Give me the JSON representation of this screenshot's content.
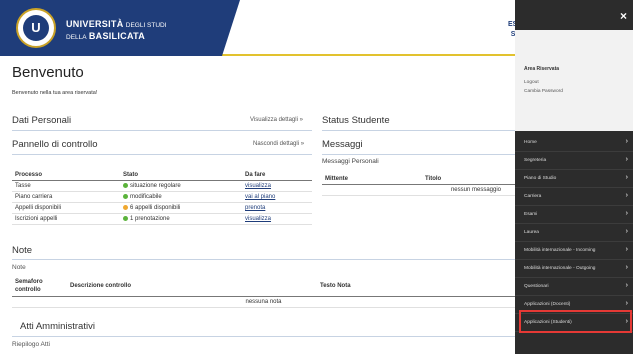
{
  "header": {
    "university_line1_bold": "UNIVERSITÀ",
    "university_line1_thin": "DEGLI STUDI",
    "university_line2_thin": "DELLA",
    "university_line2_bold": "BASILICATA",
    "logo_text": "U",
    "top_right_line1": "ESS",
    "top_right_line2": "Stu"
  },
  "welcome": {
    "title": "Benvenuto",
    "subtitle": "Benvenuto nella tua area riservata!"
  },
  "dati_personali": {
    "title": "Dati Personali",
    "link": "Visualizza dettagli »"
  },
  "status_studente": {
    "title": "Status Studente"
  },
  "pannello": {
    "title": "Pannello di controllo",
    "link": "Nascondi dettagli »",
    "headers": [
      "Processo",
      "Stato",
      "Da fare"
    ],
    "rows": [
      {
        "processo": "Tasse",
        "stato": "situazione regolare",
        "dot": "green",
        "azione": "visualizza"
      },
      {
        "processo": "Piano carriera",
        "stato": "modificabile",
        "dot": "green",
        "azione": "vai al piano"
      },
      {
        "processo": "Appelli disponibili",
        "stato": "6 appelli disponibili",
        "dot": "orange",
        "azione": "prenota"
      },
      {
        "processo": "Iscrizioni appelli",
        "stato": "1 prenotazione",
        "dot": "green",
        "azione": "visualizza"
      }
    ]
  },
  "messaggi": {
    "title": "Messaggi",
    "subtitle": "Messaggi Personali",
    "headers": [
      "Mittente",
      "Titolo"
    ],
    "empty": "nessun messaggio"
  },
  "note": {
    "title": "Note",
    "label": "Note",
    "headers": [
      "Semaforo controllo",
      "Descrizione controllo",
      "Testo Nota"
    ],
    "empty": "nessuna nota"
  },
  "atti": {
    "title": "Atti Amministrativi",
    "subtitle": "Riepilogo Atti"
  },
  "menu": {
    "close": "×",
    "area_title": "Area Riservata",
    "logout": "Logout",
    "change_password": "Cambia Password",
    "items": [
      "Home",
      "Segreteria",
      "Piano di Studio",
      "Carriera",
      "Esami",
      "Laurea",
      "Mobilità internazionale - Incoming",
      "Mobilità internazionale - Outgoing",
      "Questionari",
      "Applicazioni (Docenti)",
      "Applicazioni (Studenti)"
    ],
    "chevron": "›"
  },
  "colors": {
    "brand": "#1f3d7a",
    "accent": "#e2c22e",
    "highlight": "#e53935",
    "menu_bg": "#2c2c2c"
  }
}
